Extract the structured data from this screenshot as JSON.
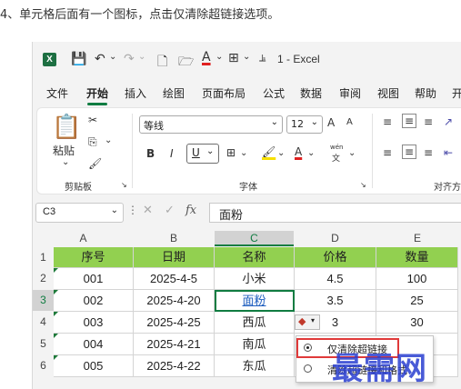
{
  "instruction": "4、单元格后面有一个图标，点击仅清除超链接选项。",
  "app": {
    "title": "1 - Excel",
    "logo_letter": "X",
    "brand_color": "#107c41"
  },
  "quick_access": {
    "icons": [
      "save-icon",
      "undo-icon",
      "redo-icon",
      "new-file-icon",
      "open-folder-icon",
      "font-color-icon",
      "borders-icon",
      "customize-icon"
    ]
  },
  "tabs": [
    "文件",
    "开始",
    "插入",
    "绘图",
    "页面布局",
    "公式",
    "数据",
    "审阅",
    "视图",
    "帮助",
    "开"
  ],
  "active_tab": "开始",
  "ribbon": {
    "clipboard": {
      "paste_label": "粘贴",
      "group_label": "剪贴板"
    },
    "font": {
      "font_name": "等线",
      "font_size": "12",
      "bold": "B",
      "italic": "I",
      "underline": "U",
      "font_color_letter": "A",
      "phonetic": "wén",
      "group_label": "字体",
      "grow": "A",
      "shrink": "A"
    },
    "alignment": {
      "group_label": "对齐方"
    }
  },
  "formula_bar": {
    "name_box": "C3",
    "fx": "fx",
    "value": "面粉"
  },
  "sheet": {
    "columns": [
      "A",
      "B",
      "C",
      "D",
      "E"
    ],
    "selected_column": "C",
    "rows": [
      "1",
      "2",
      "3",
      "4",
      "5",
      "6"
    ],
    "selected_row": "3",
    "header": [
      "序号",
      "日期",
      "名称",
      "价格",
      "数量"
    ],
    "data": [
      [
        "001",
        "2025-4-5",
        "小米",
        "4.5",
        "100"
      ],
      [
        "002",
        "2025-4-20",
        "面粉",
        "3.5",
        "25"
      ],
      [
        "003",
        "2025-4-25",
        "西瓜",
        "3",
        "30"
      ],
      [
        "004",
        "2025-4-21",
        "南瓜",
        "",
        ""
      ],
      [
        "005",
        "2025-4-22",
        "东瓜",
        "",
        ""
      ]
    ],
    "header_color": "#92d050"
  },
  "autocorrect_menu": {
    "items": [
      "仅清除超链接",
      "清除超链接和格式"
    ],
    "selected_index": 0
  },
  "watermark": "最需网"
}
